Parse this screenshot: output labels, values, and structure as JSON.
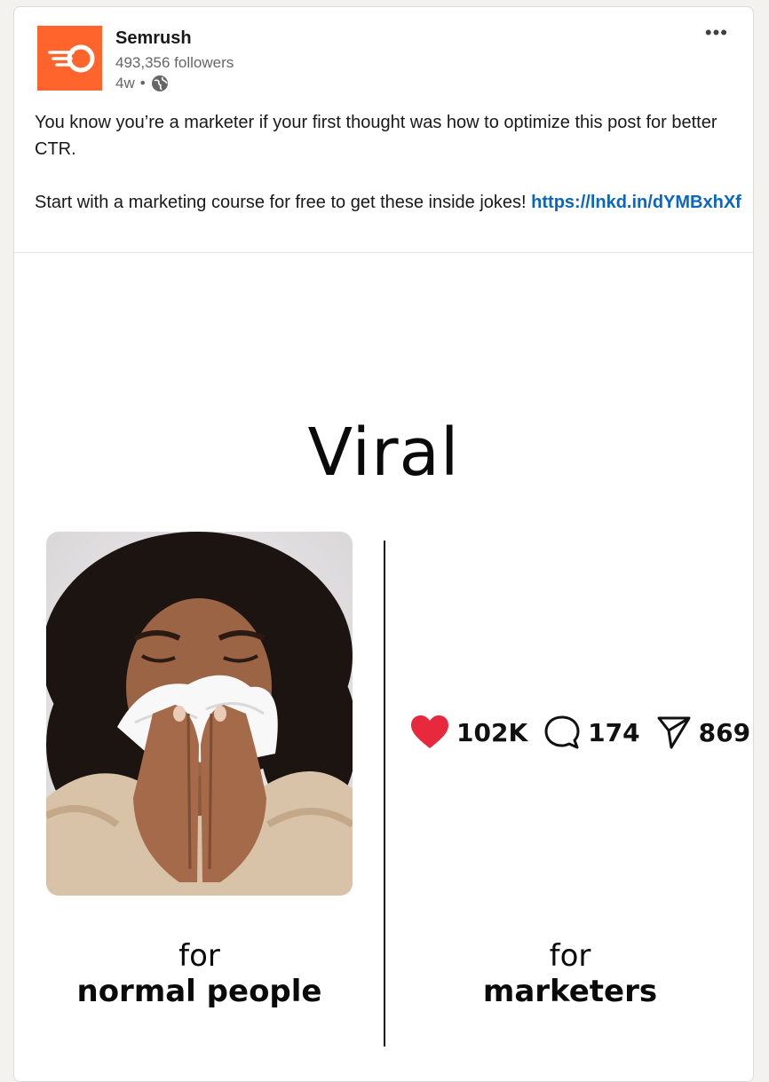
{
  "post": {
    "author": {
      "name": "Semrush",
      "followers": "493,356 followers",
      "age": "4w",
      "separator": "•",
      "visibility_icon": "globe-icon",
      "logo_icon": "semrush-fireball-logo",
      "brand_color": "#ff642d"
    },
    "more_label": "•••",
    "text": {
      "line1": "You know you’re a marketer if your first thought was how to optimize this post for better CTR.",
      "line2_prefix": "Start with a marketing course for free to get these inside jokes!",
      "link": "https://lnkd.in/dYMBxhXf"
    },
    "image": {
      "title": "Viral",
      "left_caption_for": "for",
      "left_caption_who": "normal people",
      "right_caption_for": "for",
      "right_caption_who": "marketers",
      "stats": [
        {
          "icon": "heart-icon",
          "value": "102K",
          "color": "#e8283c"
        },
        {
          "icon": "comment-icon",
          "value": "174"
        },
        {
          "icon": "send-icon",
          "value": "869"
        }
      ],
      "photo_icon": "sneezing-person-photo"
    }
  }
}
